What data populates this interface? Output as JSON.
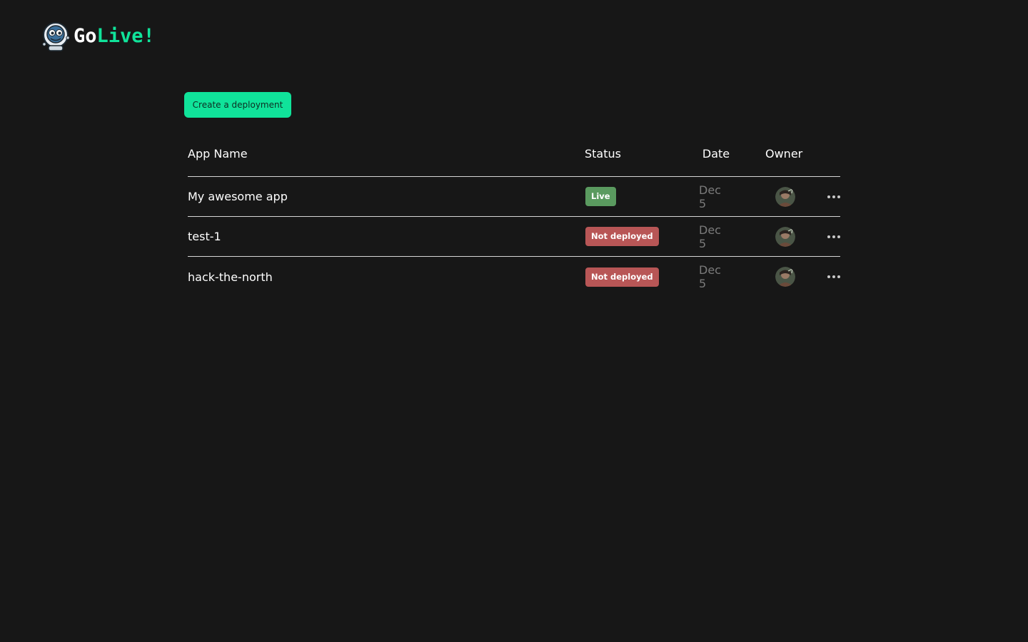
{
  "brand": {
    "name_part1": "Go",
    "name_part2": "Live!",
    "mascot_icon": "astronaut-robot-icon",
    "accent_color": "#10e39a"
  },
  "toolbar": {
    "create_label": "Create a deployment"
  },
  "table": {
    "columns": [
      "App Name",
      "Status",
      "Date",
      "Owner"
    ],
    "rows": [
      {
        "name": "My awesome app",
        "status": "Live",
        "status_color": "#5a9a5f",
        "date": "Dec 5",
        "owner_icon": "avatar-icon",
        "menu_icon": "more-horizontal-icon"
      },
      {
        "name": "test-1",
        "status": "Not deployed",
        "status_color": "#b85656",
        "date": "Dec 5",
        "owner_icon": "avatar-icon",
        "menu_icon": "more-horizontal-icon"
      },
      {
        "name": "hack-the-north",
        "status": "Not deployed",
        "status_color": "#b85656",
        "date": "Dec 5",
        "owner_icon": "avatar-icon",
        "menu_icon": "more-horizontal-icon"
      }
    ]
  }
}
